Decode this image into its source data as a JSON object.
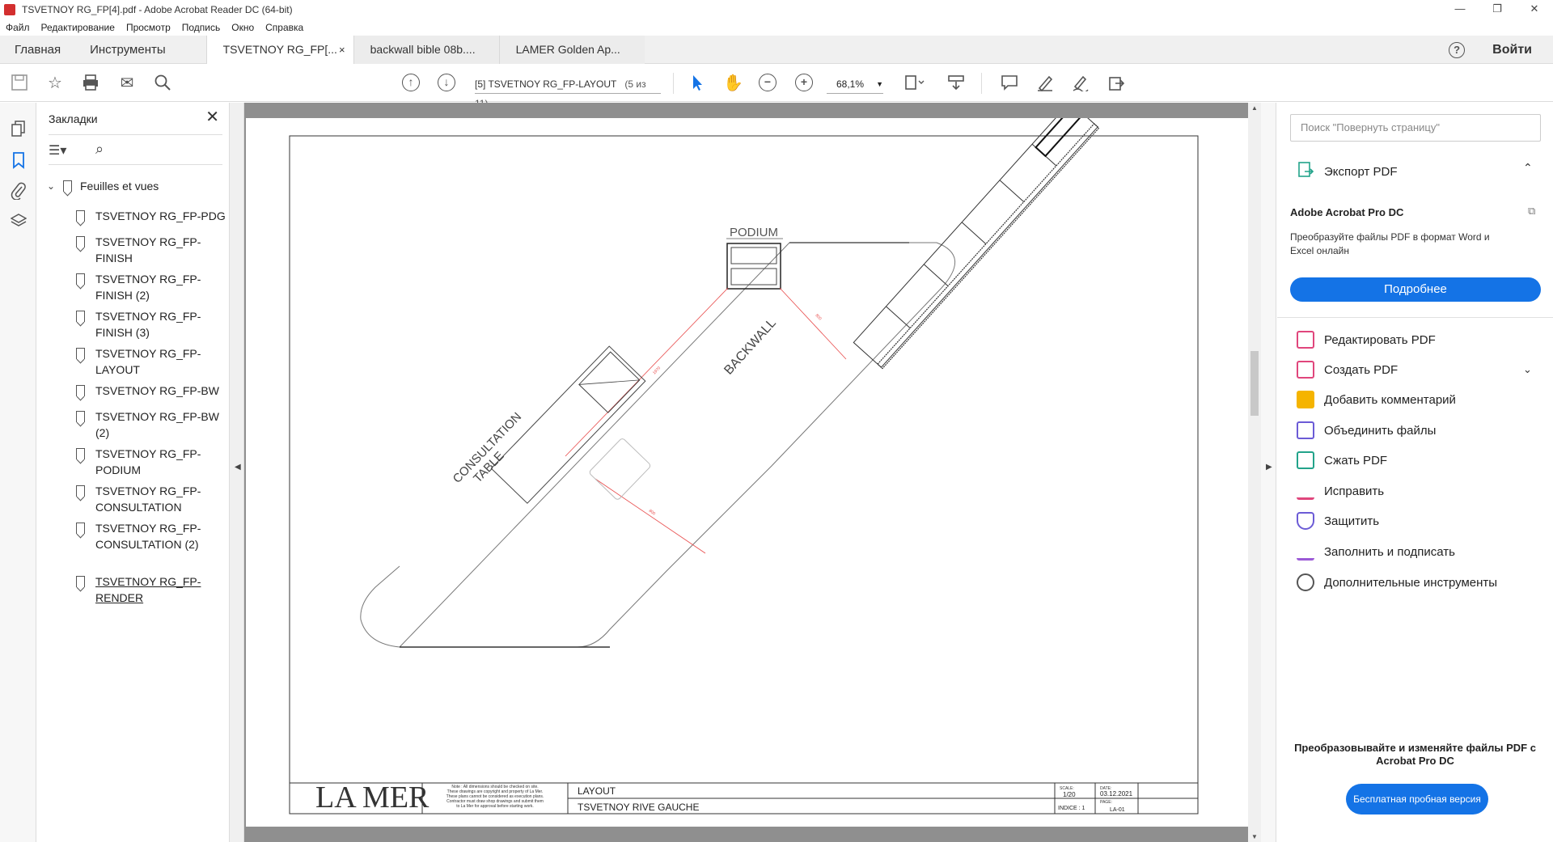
{
  "window": {
    "title": "TSVETNOY RG_FP[4].pdf - Adobe Acrobat Reader DC (64-bit)",
    "controls": [
      "—",
      "❐",
      "✕"
    ]
  },
  "menu": [
    "Файл",
    "Редактирование",
    "Просмотр",
    "Подпись",
    "Окно",
    "Справка"
  ],
  "tabs": {
    "home": "Главная",
    "tools": "Инструменты",
    "docs": [
      "TSVETNOY RG_FP[...",
      "backwall bible 08b....",
      "LAMER Golden Ap..."
    ],
    "close_glyph": "×",
    "help": "?",
    "signin": "Войти"
  },
  "toolbar": {
    "page_label": "[5] TSVETNOY RG_FP-LAYOUT",
    "page_of": "(5 из 11)",
    "zoom": "68,1%"
  },
  "bookmarks": {
    "header": "Закладки",
    "root": "Feuilles et vues",
    "items": [
      "TSVETNOY RG_FP-PDG",
      "TSVETNOY RG_FP-FINISH",
      "TSVETNOY RG_FP-FINISH (2)",
      "TSVETNOY RG_FP-FINISH (3)",
      "TSVETNOY RG_FP-LAYOUT",
      "TSVETNOY RG_FP-BW",
      "TSVETNOY RG_FP-BW (2)",
      "TSVETNOY RG_FP-PODIUM",
      "TSVETNOY RG_FP-CONSULTATION",
      "TSVETNOY RG_FP-CONSULTATION (2)",
      "TSVETNOY RG_FP-RENDER"
    ]
  },
  "drawing": {
    "podium": "PODIUM",
    "backwall": "BACKWALL",
    "consultation": "CONSULTATION TABLE",
    "dim1": "1970",
    "dim2": "800",
    "dim3": "800",
    "brand": "LA MER",
    "note": "Note : All dimensions should be checked on site. These drawings are copyright and property of La Mer. These plans cannot be considered as execution plans. Contractor must draw shop drawings and submit them to La Mer for approval before starting work.",
    "title1": "LAYOUT",
    "title2": "TSVETNOY RIVE GAUCHE",
    "scale_label": "SCALE:",
    "scale": "1/20",
    "indice": "INDICE : 1",
    "date_label": "DATE:",
    "date": "03.12.2021",
    "page_label": "PAGE:",
    "page": "LA-01"
  },
  "right_pane": {
    "search_placeholder": "Поиск \"Повернуть страницу\"",
    "export": "Экспорт PDF",
    "pro_title": "Adobe Acrobat Pro DC",
    "pro_desc": "Преобразуйте файлы PDF в формат Word и Excel онлайн",
    "more_btn": "Подробнее",
    "tools": [
      {
        "label": "Редактировать PDF",
        "color": "#e0467c"
      },
      {
        "label": "Создать PDF",
        "color": "#e0467c"
      },
      {
        "label": "Добавить комментарий",
        "color": "#f5b400"
      },
      {
        "label": "Объединить файлы",
        "color": "#6b5bd6"
      },
      {
        "label": "Сжать PDF",
        "color": "#22a38a"
      },
      {
        "label": "Исправить",
        "color": "#e0467c"
      },
      {
        "label": "Защитить",
        "color": "#6b5bd6"
      },
      {
        "label": "Заполнить и подписать",
        "color": "#9b59d6"
      },
      {
        "label": "Дополнительные инструменты",
        "color": "#555555"
      }
    ],
    "promo": "Преобразовывайте и изменяйте файлы PDF с Acrobat Pro DC",
    "trial": "Бесплатная пробная версия"
  }
}
